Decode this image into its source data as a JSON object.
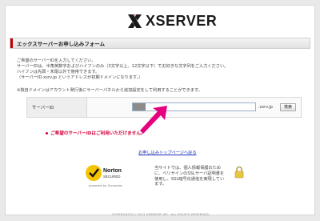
{
  "header": {
    "brand": "XSERVER"
  },
  "form": {
    "title": "エックスサーバーお申し込みフォーム",
    "intro_lines": [
      "ご希望のサーバーIDを入力してください。",
      "サーバーIDは、半角英数字およびハイフンのみ（3文字以上、12文字以下）でお好きな文字列をご入力ください。",
      "ハイフンは先頭・末尾以外で使用できます。",
      "（サーバーID.xsrv.jp というアドレスが初期ドメインになります。）"
    ],
    "notice": "※独自ドメインはアカウント発行後にサーバーパネルから追加設定をして利用することができます。",
    "server_id_label": "サーバーID",
    "server_id_value": "",
    "domain_suffix": ".xsrv.jp",
    "search_button": "検索",
    "error_message": "ご希望のサーバーIDはご利用いただけません。",
    "back_link": "お申し込みトップページへ戻る"
  },
  "security": {
    "norton_brand": "Norton",
    "norton_sub": "SECURED",
    "norton_powered": "powered by Symantec",
    "ssl_note": "当サイトでは、個人情報保護のために、ベリサインのSSLサーバ証明書を使用し、SSL暗号化通信を実現しています。"
  },
  "footer": {
    "copyright": "COPYRIGHT(C) 2013 XSERVER INC. ALL RIGHTS RESERVED."
  },
  "colors": {
    "accent": "#c00000",
    "error": "#d5003a",
    "link": "#1a2db3",
    "norton_yellow": "#f5c400"
  },
  "icons": {
    "logo": "xserver-x-logo",
    "arrow": "pink-pointer-arrow",
    "lock": "padlock-icon",
    "seal": "norton-checkmark-seal"
  }
}
